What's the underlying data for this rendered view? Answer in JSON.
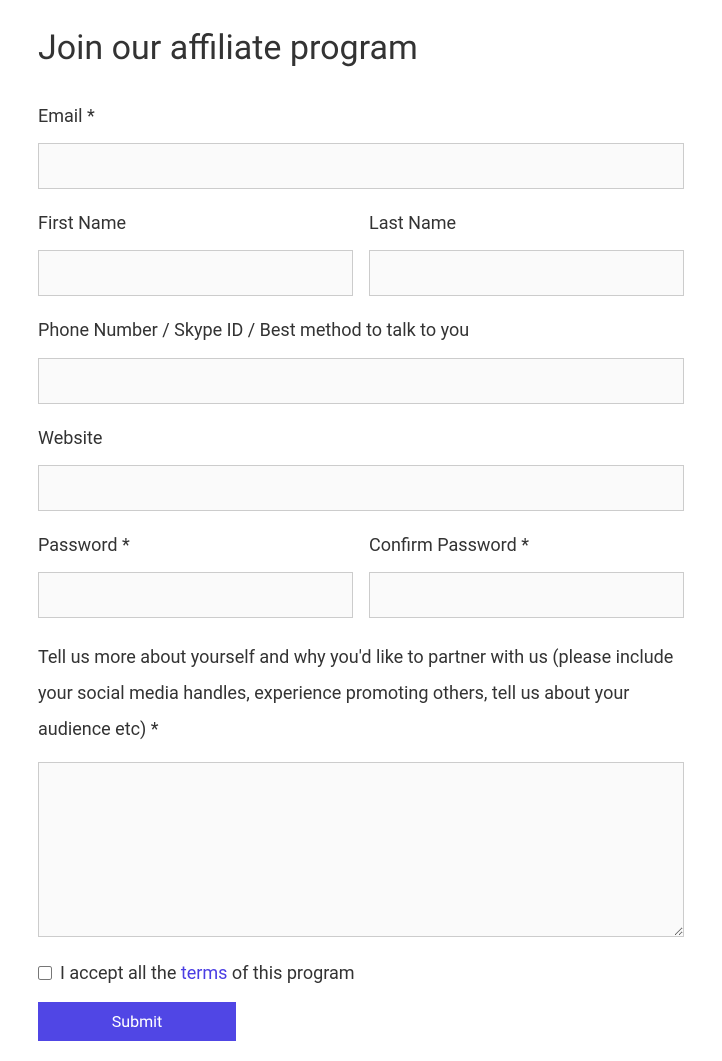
{
  "heading": "Join our affiliate program",
  "fields": {
    "email": {
      "label": "Email *",
      "value": ""
    },
    "first_name": {
      "label": "First Name",
      "value": ""
    },
    "last_name": {
      "label": "Last Name",
      "value": ""
    },
    "phone": {
      "label": "Phone Number / Skype ID / Best method to talk to you",
      "value": ""
    },
    "website": {
      "label": "Website",
      "value": ""
    },
    "password": {
      "label": "Password *",
      "value": ""
    },
    "confirm_password": {
      "label": "Confirm Password *",
      "value": ""
    },
    "about": {
      "label": "Tell us more about yourself and why you'd like to partner with us (please include your social media handles, experience promoting others, tell us about your audience etc) *",
      "value": ""
    }
  },
  "terms": {
    "prefix": "I accept all the ",
    "link_text": "terms",
    "suffix": " of this program",
    "checked": false
  },
  "submit_label": "Submit"
}
